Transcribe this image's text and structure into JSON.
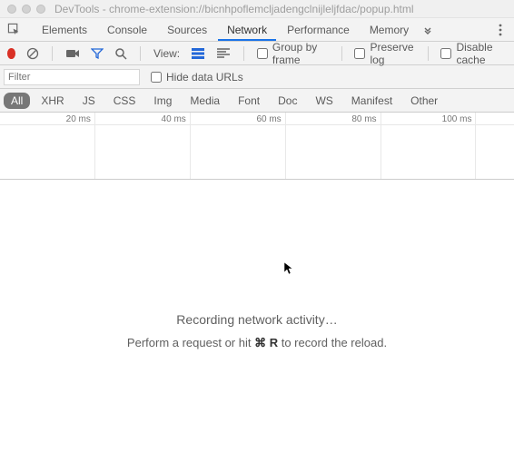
{
  "window": {
    "title": "DevTools - chrome-extension://bicnhpoflemcljadengclnijleljfdac/popup.html"
  },
  "tabs": {
    "t0": "Elements",
    "t1": "Console",
    "t2": "Sources",
    "t3": "Network",
    "t4": "Performance",
    "t5": "Memory",
    "active": "Network"
  },
  "toolbar": {
    "view_label": "View:",
    "group_label": "Group by frame",
    "preserve_label": "Preserve log",
    "disable_label": "Disable cache"
  },
  "filter": {
    "placeholder": "Filter",
    "hide_urls_label": "Hide data URLs"
  },
  "types": {
    "all": "All",
    "xhr": "XHR",
    "js": "JS",
    "css": "CSS",
    "img": "Img",
    "media": "Media",
    "font": "Font",
    "doc": "Doc",
    "ws": "WS",
    "manifest": "Manifest",
    "other": "Other"
  },
  "timeline": {
    "t1": "20 ms",
    "t2": "40 ms",
    "t3": "60 ms",
    "t4": "80 ms",
    "t5": "100 ms"
  },
  "empty": {
    "title": "Recording network activity…",
    "sub_before": "Perform a request or hit ",
    "sub_key": "⌘ R",
    "sub_after": " to record the reload."
  }
}
